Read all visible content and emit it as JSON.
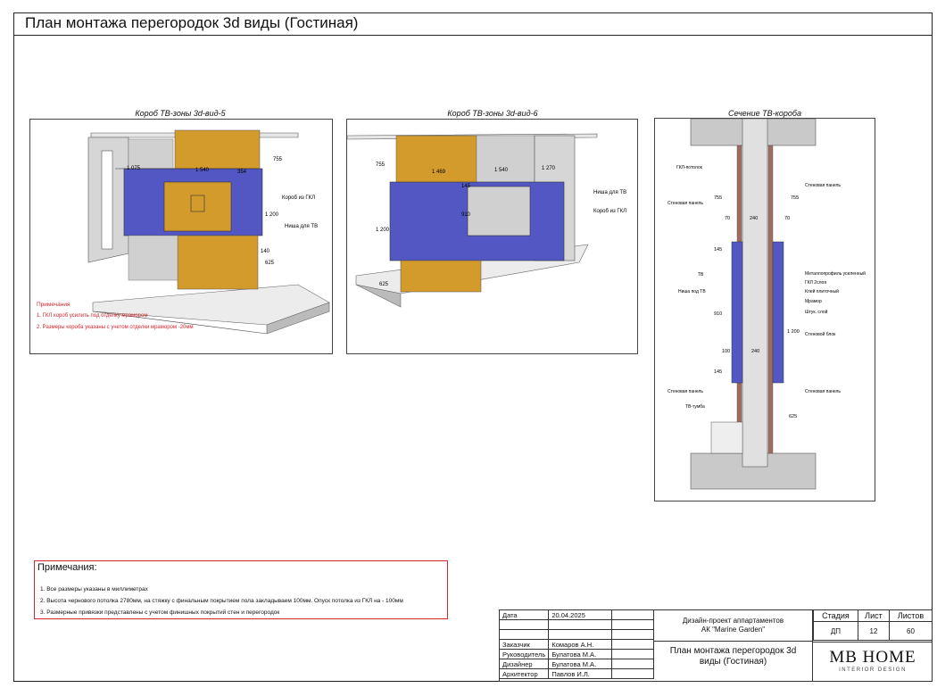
{
  "page_title": "План монтажа перегородок 3d виды (Гостиная)",
  "panels": {
    "view5": {
      "caption": "Короб ТВ-зоны 3d-вид-5",
      "labels": {
        "d1075": "1 075",
        "d1540": "1 540",
        "d354": "354",
        "d755": "755",
        "d1200": "1 200",
        "d140": "140",
        "d625": "625",
        "box": "Короб из ГКЛ",
        "niche": "Ниша для ТВ"
      },
      "notes_title": "Примечания",
      "notes": [
        "1. ГКЛ короб усилить под отделку мрамором",
        "2. Размеры короба указаны с учетом отделки мрамором -20мм"
      ]
    },
    "view6": {
      "caption": "Короб ТВ-зоны 3d-вид-6",
      "labels": {
        "d1469": "1 469",
        "d1540": "1 540",
        "d1270": "1 270",
        "d755": "755",
        "d1200": "1 200",
        "d910": "910",
        "d625": "625",
        "d145": "145",
        "niche": "Ниша для ТВ",
        "box": "Короб из ГКЛ"
      }
    },
    "section": {
      "caption": "Сечение ТВ-короба",
      "left_labels": [
        "ГКЛ-потолок",
        "Стеновая панель",
        "ТВ",
        "Ниша под ТВ",
        "Стеновая панель",
        "ТВ-тумба"
      ],
      "right_labels": [
        "Стеновая панель",
        "Металлопрофиль усиленный",
        "ГКЛ 2слоя",
        "Клей плиточный",
        "Мрамор",
        "Штук. слой",
        "Стеновой блок",
        "Стеновая панель"
      ],
      "dims": {
        "d755a": "755",
        "d755b": "755",
        "d70a": "70",
        "d240a": "240",
        "d70b": "70",
        "d145a": "145",
        "d910": "910",
        "d1200": "1 200",
        "d100": "100",
        "d240b": "240",
        "d145b": "145",
        "d625": "625"
      }
    }
  },
  "notes": {
    "title": "Примечания:",
    "items": [
      "1. Все размеры указаны в миллиметрах",
      "2. Высота чернового потолка 2780мм, на стяжку с финальным покрытием пола закладываем 100мм. Опуск потолка из ГКЛ на - 100мм",
      "3. Размерные привязки представлены с учетом финишных покрытий стен и перегородок"
    ]
  },
  "title_block": {
    "date_label": "Дата",
    "date_value": "20.04.2025",
    "rows": [
      {
        "role": "Заказчик",
        "name": "Комаров А.Н."
      },
      {
        "role": "Руководитель",
        "name": "Булатова М.А."
      },
      {
        "role": "Дизайнер",
        "name": "Булатова М.А."
      },
      {
        "role": "Архитектор",
        "name": "Павлов И.Л."
      }
    ],
    "project_line1": "Дизайн-проект аппартаментов",
    "project_line2": "АК \"Marine Garden\"",
    "sheet_title": "План монтажа перегородок 3d виды (Гостиная)",
    "stage_label": "Стадия",
    "sheet_label": "Лист",
    "sheets_label": "Листов",
    "stage_value": "ДП",
    "sheet_value": "12",
    "sheets_value": "60",
    "logo_main": "MB HOME",
    "logo_sub": "INTERIOR DESIGN"
  },
  "colors": {
    "accent_red": "#d1262b",
    "orange": "#d39a2c",
    "blue": "#5257c4",
    "grey": "#c9c9c9",
    "brown": "#a06a5e"
  }
}
